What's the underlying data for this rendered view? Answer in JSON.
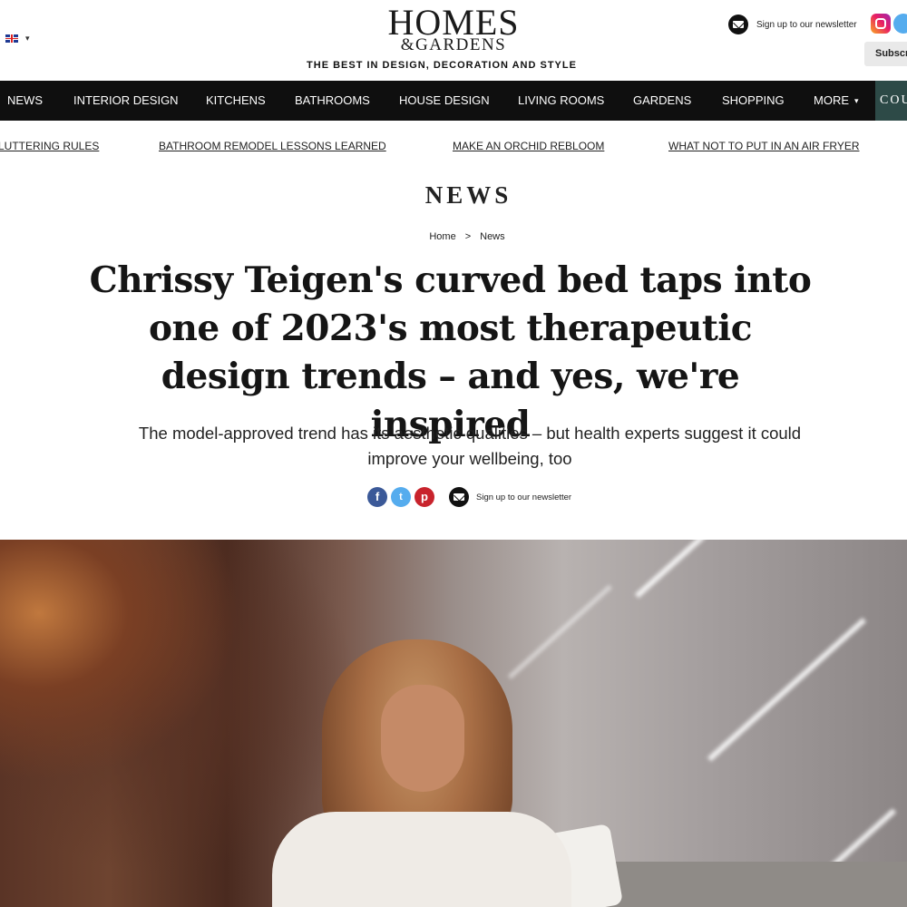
{
  "header": {
    "logo_main": "HOMES",
    "logo_sub": "&GARDENS",
    "tagline": "THE BEST IN DESIGN, DECORATION AND STYLE",
    "region_caret": "▾",
    "newsletter_label": "Sign up to our newsletter",
    "subscribe_label": "Subscribe"
  },
  "nav": {
    "items": [
      "NEWS",
      "INTERIOR DESIGN",
      "KITCHENS",
      "BATHROOMS",
      "HOUSE DESIGN",
      "LIVING ROOMS",
      "GARDENS",
      "SHOPPING",
      "MORE"
    ],
    "more_caret": "▾",
    "cta_label": "COUPONS"
  },
  "trending": [
    "LUTTERING RULES",
    "BATHROOM REMODEL LESSONS LEARNED",
    "MAKE AN ORCHID REBLOOM",
    "WHAT NOT TO PUT IN AN AIR FRYER"
  ],
  "article": {
    "section": "NEWS",
    "breadcrumb": {
      "home": "Home",
      "separator": ">",
      "current": "News"
    },
    "headline": "Chrissy Teigen's curved bed taps into one of 2023's most therapeutic design trends – and yes, we're inspired",
    "standfirst": "The model-approved trend has its aesthetic qualities – but health experts suggest it could improve your wellbeing, too",
    "share": {
      "facebook": "f",
      "twitter": "t",
      "pinterest": "p",
      "newsletter_label": "Sign up to our newsletter"
    }
  }
}
